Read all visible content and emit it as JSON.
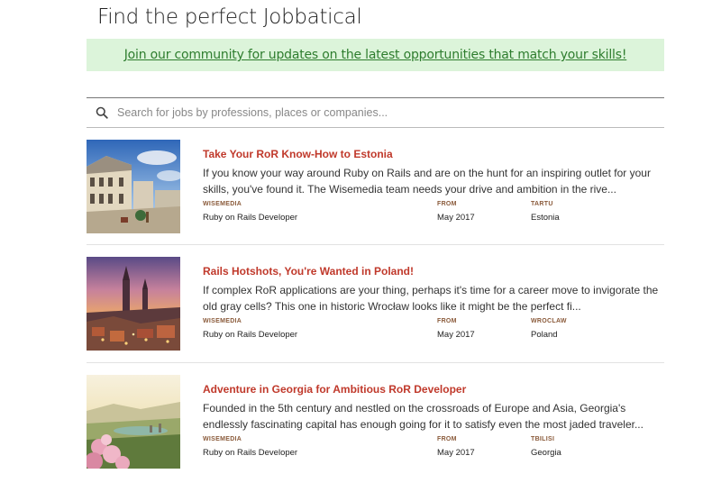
{
  "page": {
    "title": "Find the perfect Jobbatical"
  },
  "banner": {
    "text": "Join our community for updates on the latest opportunities that match your skills!"
  },
  "search": {
    "icon": "search-icon",
    "placeholder": "Search for jobs by professions, places or companies..."
  },
  "jobs": [
    {
      "title": "Take Your RoR Know-How to Estonia",
      "description": "If you know your way around Ruby on Rails and are on the hunt for an inspiring outlet for your skills, you've found it. The Wisemedia team needs your drive and ambition in the rive...",
      "company_label": "WISEMEDIA",
      "role": "Ruby on Rails Developer",
      "from_label": "FROM",
      "from_value": "May 2017",
      "city_label": "TARTU",
      "country": "Estonia"
    },
    {
      "title": "Rails Hotshots, You're Wanted in Poland!",
      "description": "If complex RoR applications are your thing, perhaps it's time for a career move to invigorate the old gray cells? This one in historic Wrocław looks like it might be the perfect fi...",
      "company_label": "WISEMEDIA",
      "role": "Ruby on Rails Developer",
      "from_label": "FROM",
      "from_value": "May 2017",
      "city_label": "WROCLAW",
      "country": "Poland"
    },
    {
      "title": "Adventure in Georgia for Ambitious RoR Developer",
      "description": "Founded in the 5th century and nestled on the crossroads of Europe and Asia, Georgia's endlessly fascinating capital has enough going for it to satisfy even the most jaded traveler...",
      "company_label": "WISEMEDIA",
      "role": "Ruby on Rails Developer",
      "from_label": "FROM",
      "from_value": "May 2017",
      "city_label": "TBILISI",
      "country": "Georgia"
    }
  ]
}
